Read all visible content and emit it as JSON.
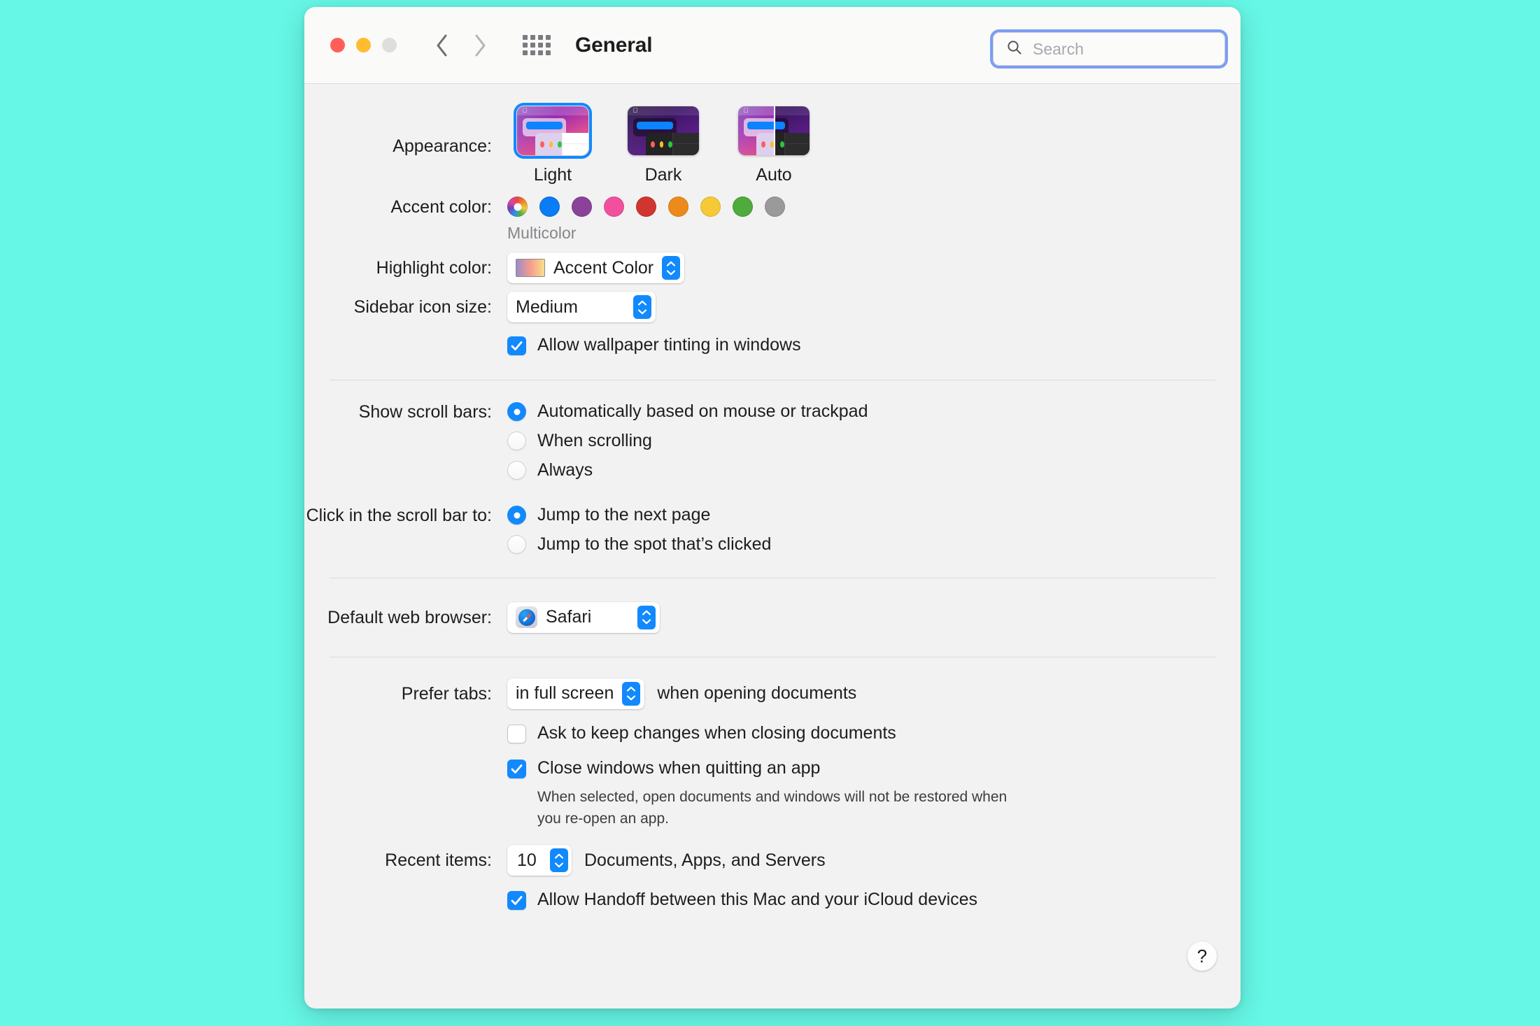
{
  "window": {
    "title": "General",
    "traffic_lights": [
      "close",
      "minimize",
      "maximize"
    ],
    "nav": {
      "back": "back-chevron",
      "forward": "forward-chevron",
      "grid": "all-preferences-grid"
    },
    "search": {
      "placeholder": "Search",
      "value": "",
      "icon": "search-icon"
    },
    "help_label": "?"
  },
  "appearance": {
    "label": "Appearance:",
    "options": [
      {
        "label": "Light",
        "selected": true
      },
      {
        "label": "Dark",
        "selected": false
      },
      {
        "label": "Auto",
        "selected": false
      }
    ]
  },
  "accent": {
    "label": "Accent color:",
    "caption": "Multicolor",
    "swatches": [
      {
        "name": "multicolor",
        "color": "multicolor",
        "selected": true
      },
      {
        "name": "blue",
        "color": "#0a7cf6",
        "selected": false
      },
      {
        "name": "purple",
        "color": "#8a4399",
        "selected": false
      },
      {
        "name": "pink",
        "color": "#f2509e",
        "selected": false
      },
      {
        "name": "red",
        "color": "#d1352f",
        "selected": false
      },
      {
        "name": "orange",
        "color": "#ec8b1c",
        "selected": false
      },
      {
        "name": "yellow",
        "color": "#f6ca37",
        "selected": false
      },
      {
        "name": "green",
        "color": "#4fab3c",
        "selected": false
      },
      {
        "name": "graphite",
        "color": "#9a9a9a",
        "selected": false
      }
    ]
  },
  "highlight": {
    "label": "Highlight color:",
    "value": "Accent Color"
  },
  "sidebar_icon_size": {
    "label": "Sidebar icon size:",
    "value": "Medium"
  },
  "wallpaper_tinting": {
    "label": "Allow wallpaper tinting in windows",
    "checked": true
  },
  "scroll_bars": {
    "label": "Show scroll bars:",
    "options": [
      {
        "label": "Automatically based on mouse or trackpad",
        "selected": true
      },
      {
        "label": "When scrolling",
        "selected": false
      },
      {
        "label": "Always",
        "selected": false
      }
    ]
  },
  "scroll_bar_click": {
    "label": "Click in the scroll bar to:",
    "options": [
      {
        "label": "Jump to the next page",
        "selected": true
      },
      {
        "label": "Jump to the spot that’s clicked",
        "selected": false
      }
    ]
  },
  "default_browser": {
    "label": "Default web browser:",
    "value": "Safari",
    "icon": "safari-icon"
  },
  "prefer_tabs": {
    "label": "Prefer tabs:",
    "value": "in full screen",
    "suffix": "when opening documents"
  },
  "ask_keep_changes": {
    "label": "Ask to keep changes when closing documents",
    "checked": false
  },
  "close_windows": {
    "label": "Close windows when quitting an app",
    "checked": true,
    "help": "When selected, open documents and windows will not be restored when you re-open an app."
  },
  "recent_items": {
    "label": "Recent items:",
    "value": "10",
    "suffix": "Documents, Apps, and Servers"
  },
  "handoff": {
    "label": "Allow Handoff between this Mac and your iCloud devices",
    "checked": true
  },
  "colors": {
    "accent_blue": "#1289fd",
    "desktop": "#66f7e6",
    "window_body": "#f2f2f2",
    "titlebar": "#fafaf9"
  }
}
